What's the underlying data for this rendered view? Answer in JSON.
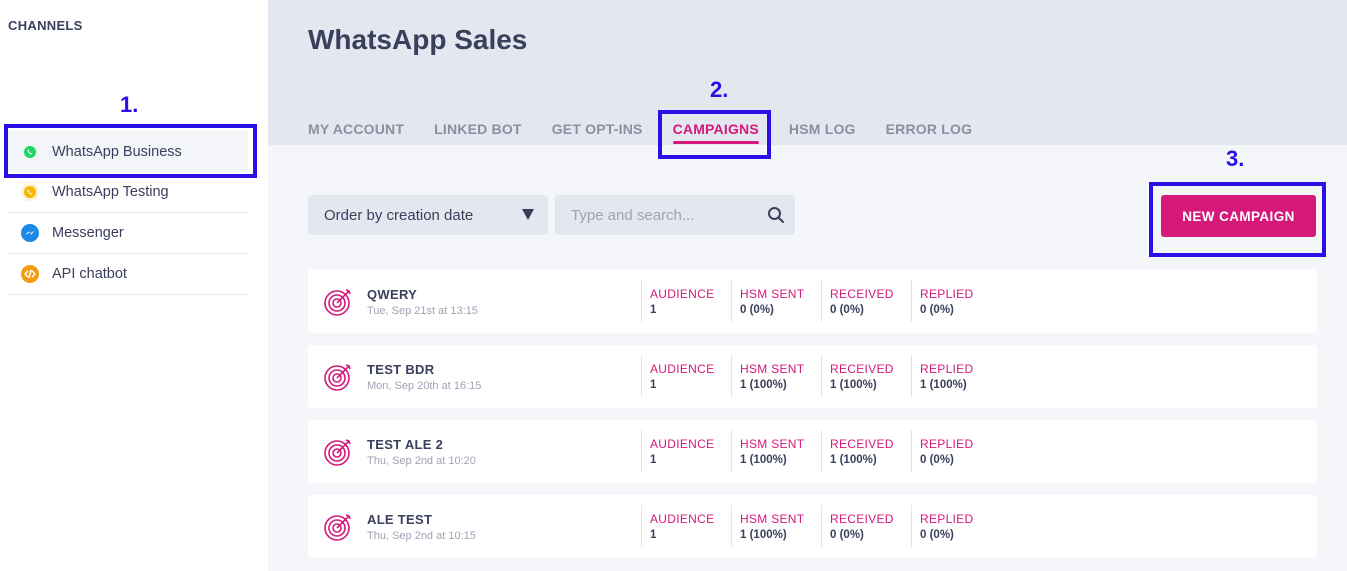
{
  "sidebar": {
    "title": "CHANNELS",
    "items": [
      {
        "label": "WhatsApp Business",
        "icon": "whatsapp-icon",
        "color": "#25d366",
        "active": true
      },
      {
        "label": "WhatsApp Testing",
        "icon": "whatsapp-testing-icon",
        "color": "#f5b800",
        "active": false
      },
      {
        "label": "Messenger",
        "icon": "messenger-icon",
        "color": "#1e88e5",
        "active": false
      },
      {
        "label": "API chatbot",
        "icon": "code-icon",
        "color": "#f39c12",
        "active": false
      }
    ]
  },
  "header": {
    "title": "WhatsApp Sales",
    "tabs": [
      {
        "label": "MY ACCOUNT",
        "active": false
      },
      {
        "label": "LINKED BOT",
        "active": false
      },
      {
        "label": "GET OPT-INS",
        "active": false
      },
      {
        "label": "CAMPAIGNS",
        "active": true
      },
      {
        "label": "HSM LOG",
        "active": false
      },
      {
        "label": "ERROR LOG",
        "active": false
      }
    ]
  },
  "toolbar": {
    "order_label": "Order by creation date",
    "search_placeholder": "Type and search...",
    "new_campaign_label": "NEW CAMPAIGN"
  },
  "stat_labels": {
    "audience": "AUDIENCE",
    "hsm_sent": "HSM SENT",
    "received": "RECEIVED",
    "replied": "REPLIED"
  },
  "campaigns": [
    {
      "name": "QWERY",
      "date": "Tue, Sep 21st at 13:15",
      "audience": "1",
      "hsm_sent": "0 (0%)",
      "received": "0 (0%)",
      "replied": "0 (0%)"
    },
    {
      "name": "TEST BDR",
      "date": "Mon, Sep 20th at 16:15",
      "audience": "1",
      "hsm_sent": "1 (100%)",
      "received": "1 (100%)",
      "replied": "1 (100%)"
    },
    {
      "name": "TEST ALE 2",
      "date": "Thu, Sep 2nd at 10:20",
      "audience": "1",
      "hsm_sent": "1 (100%)",
      "received": "1 (100%)",
      "replied": "0 (0%)"
    },
    {
      "name": "ALE TEST",
      "date": "Thu, Sep 2nd at 10:15",
      "audience": "1",
      "hsm_sent": "1 (100%)",
      "received": "0 (0%)",
      "replied": "0 (0%)"
    }
  ],
  "annotations": [
    "1.",
    "2.",
    "3."
  ],
  "colors": {
    "accent": "#d4197a",
    "annotation": "#2a0fe6",
    "header_bg": "#e3e7ef",
    "text": "#3a3f5c"
  }
}
